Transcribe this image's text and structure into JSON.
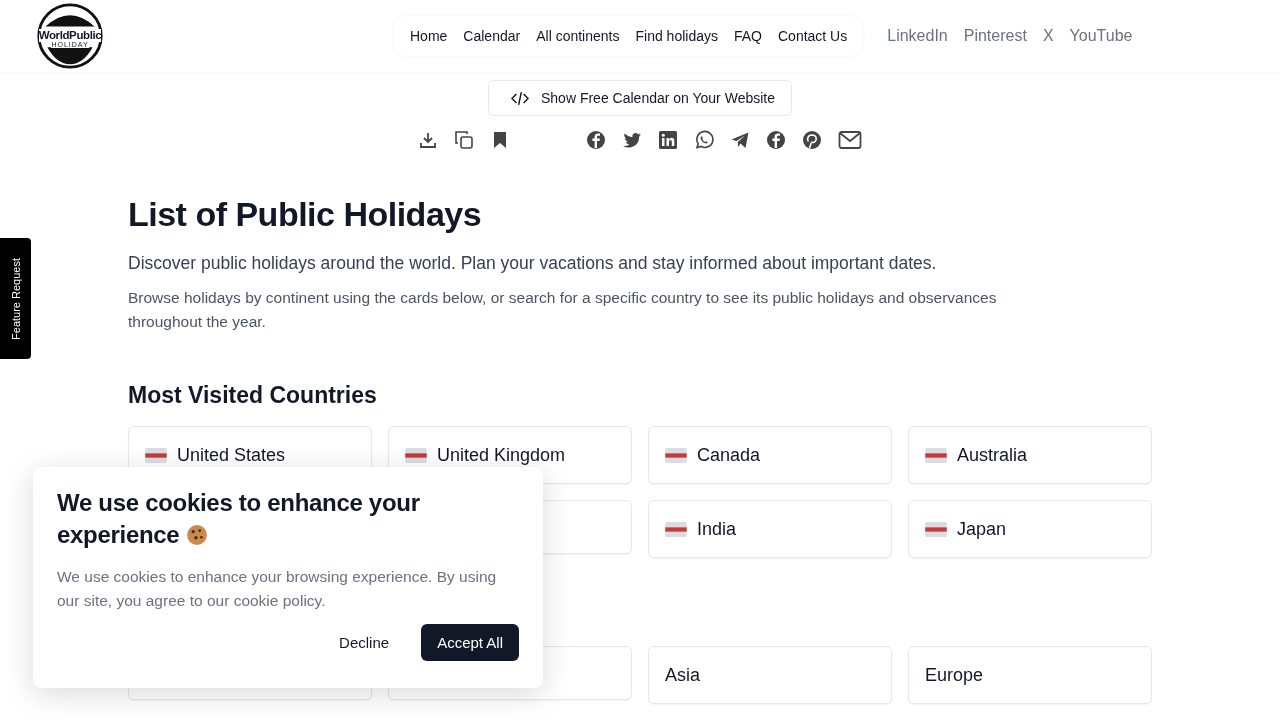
{
  "logo": {
    "title": "WorldPublic",
    "subtitle": "HOLIDAY"
  },
  "nav": [
    {
      "label": "Home"
    },
    {
      "label": "Calendar"
    },
    {
      "label": "All continents"
    },
    {
      "label": "Find holidays"
    },
    {
      "label": "FAQ"
    },
    {
      "label": "Contact Us"
    }
  ],
  "social_links": [
    "LinkedIn",
    "Pinterest",
    "X",
    "YouTube"
  ],
  "embed_button": "Show Free Calendar on Your Website",
  "feature_tab": "Feature Request",
  "title": "List of Public Holidays",
  "lead": "Discover public holidays around the world. Plan your vacations and stay informed about important dates.",
  "intro": "Browse holidays by continent using the cards below, or search for a specific country to see its public holidays and observances throughout the year.",
  "countries_heading": "Most Visited Countries",
  "countries": [
    {
      "name": "United States"
    },
    {
      "name": "United Kingdom"
    },
    {
      "name": "Canada"
    },
    {
      "name": "Australia"
    },
    {
      "name": "India"
    },
    {
      "name": "Japan"
    }
  ],
  "continents": [
    {
      "name": "Asia"
    },
    {
      "name": "Europe"
    }
  ],
  "cookie": {
    "title": "We use cookies to enhance your experience",
    "text": "We use cookies to enhance your browsing experience. By using our site, you agree to our cookie policy.",
    "decline": "Decline",
    "accept": "Accept All"
  }
}
